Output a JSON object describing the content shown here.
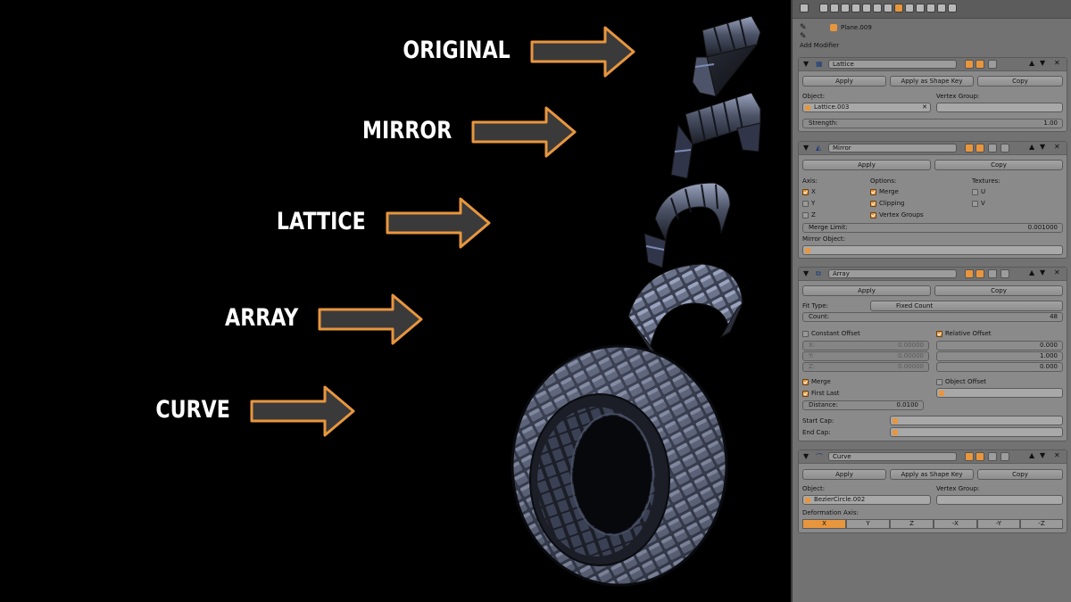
{
  "annotations": {
    "steps": [
      {
        "label": "ORIGINAL"
      },
      {
        "label": "MIRROR"
      },
      {
        "label": "LATTICE"
      },
      {
        "label": "ARRAY"
      },
      {
        "label": "CURVE"
      }
    ],
    "arrow_color": "#e8963e",
    "arrow_fill": "#3a3a3a"
  },
  "panel": {
    "object_name": "Plane.009",
    "add_modifier": "Add Modifier",
    "modifiers": {
      "lattice": {
        "name": "Lattice",
        "apply": "Apply",
        "apply_shape_key": "Apply as Shape Key",
        "copy": "Copy",
        "object_label": "Object:",
        "object_value": "Lattice.003",
        "vertex_group_label": "Vertex Group:",
        "strength_label": "Strength:",
        "strength_value": "1.00"
      },
      "mirror": {
        "name": "Mirror",
        "apply": "Apply",
        "copy": "Copy",
        "axis_label": "Axis:",
        "options_label": "Options:",
        "textures_label": "Textures:",
        "axes": [
          "X",
          "Y",
          "Z"
        ],
        "axes_on": [
          true,
          false,
          false
        ],
        "options": [
          "Merge",
          "Clipping",
          "Vertex Groups"
        ],
        "options_on": [
          true,
          true,
          true
        ],
        "textures": [
          "U",
          "V"
        ],
        "textures_on": [
          false,
          false
        ],
        "merge_limit_label": "Merge Limit:",
        "merge_limit_value": "0.001000",
        "mirror_object_label": "Mirror Object:"
      },
      "array": {
        "name": "Array",
        "apply": "Apply",
        "copy": "Copy",
        "fit_type_label": "Fit Type:",
        "fit_type_value": "Fixed Count",
        "count_label": "Count:",
        "count_value": "48",
        "constant_offset": "Constant Offset",
        "constant_offset_on": false,
        "relative_offset": "Relative Offset",
        "relative_offset_on": true,
        "constant_axes": [
          "X:",
          "Y:",
          "Z:"
        ],
        "constant_values": [
          "0.00000",
          "0.00000",
          "0.00000"
        ],
        "relative_values": [
          "0.000",
          "1.000",
          "0.000"
        ],
        "merge": "Merge",
        "merge_on": true,
        "first_last": "First Last",
        "first_last_on": true,
        "object_offset": "Object Offset",
        "object_offset_on": false,
        "distance_label": "Distance:",
        "distance_value": "0.0100",
        "start_cap_label": "Start Cap:",
        "end_cap_label": "End Cap:"
      },
      "curve": {
        "name": "Curve",
        "apply": "Apply",
        "apply_shape_key": "Apply as Shape Key",
        "copy": "Copy",
        "object_label": "Object:",
        "object_value": "BezierCircle.002",
        "vertex_group_label": "Vertex Group:",
        "deformation_axis_label": "Deformation Axis:",
        "axes": [
          "X",
          "Y",
          "Z",
          "-X",
          "-Y",
          "-Z"
        ],
        "selected_axis": "X"
      }
    }
  }
}
